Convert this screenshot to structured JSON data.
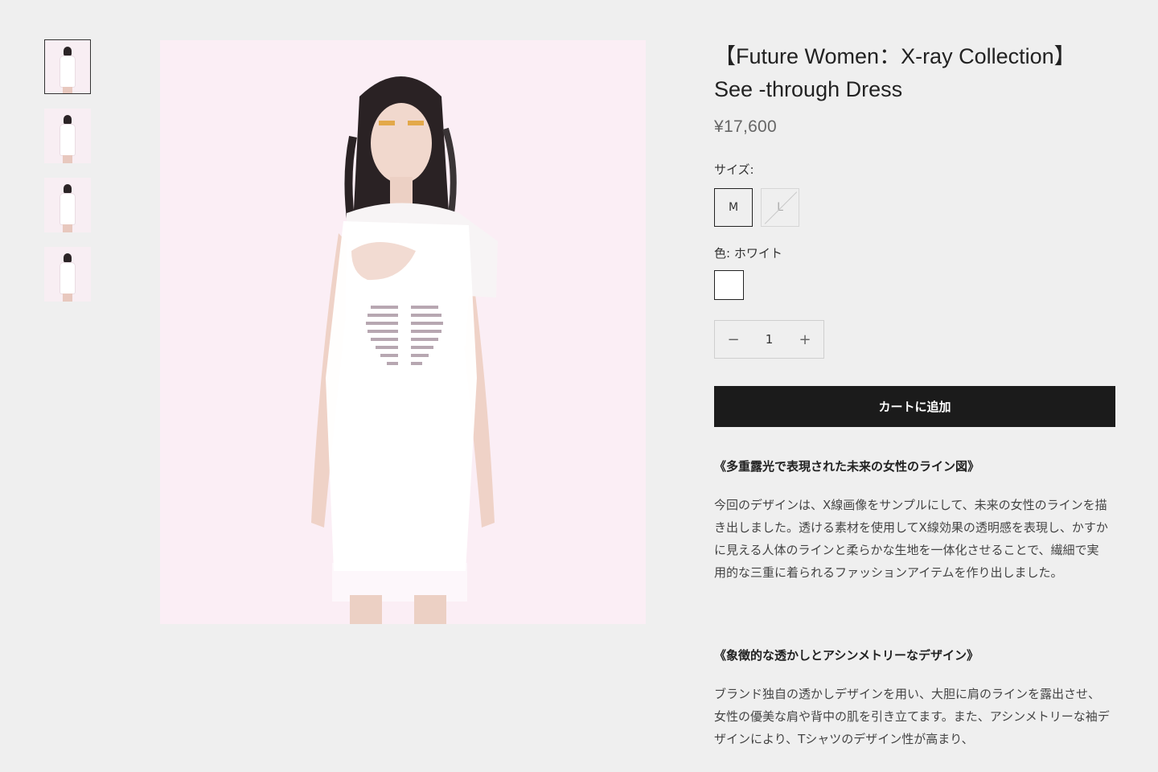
{
  "gallery": {
    "thumbnails": [
      "thumbnail-1",
      "thumbnail-2",
      "thumbnail-3",
      "thumbnail-4"
    ],
    "active_index": 0
  },
  "product": {
    "title_line1": "【Future Women：X-ray Collection】",
    "title_line2": "See -through Dress",
    "price": "¥17,600",
    "size_label": "サイズ:",
    "sizes": [
      {
        "label": "M",
        "selected": true,
        "available": true
      },
      {
        "label": "L",
        "selected": false,
        "available": false
      }
    ],
    "color_label": "色: ホワイト",
    "color_swatch": "#ffffff",
    "quantity": "1",
    "qty_minus": "−",
    "qty_plus": "+",
    "add_to_cart": "カートに追加"
  },
  "description": {
    "heading1": "《多重露光で表現された未来の女性のライン図》",
    "body1": "今回のデザインは、X線画像をサンプルにして、未来の女性のラインを描き出しました。透ける素材を使用してX線効果の透明感を表現し、かすかに見える人体のラインと柔らかな生地を一体化させることで、繊細で実用的な三重に着られるファッションアイテムを作り出しました。",
    "heading2": "《象徴的な透かしとアシンメトリーなデザイン》",
    "body2": "ブランド独自の透かしデザインを用い、大胆に肩のラインを露出させ、女性の優美な肩や背中の肌を引き立てます。また、アシンメトリーな袖デザインにより、Tシャツのデザイン性が高まり、"
  },
  "colors": {
    "background": "#efefef",
    "button": "#1b1b1b",
    "image_bg": "#fbeef5"
  }
}
